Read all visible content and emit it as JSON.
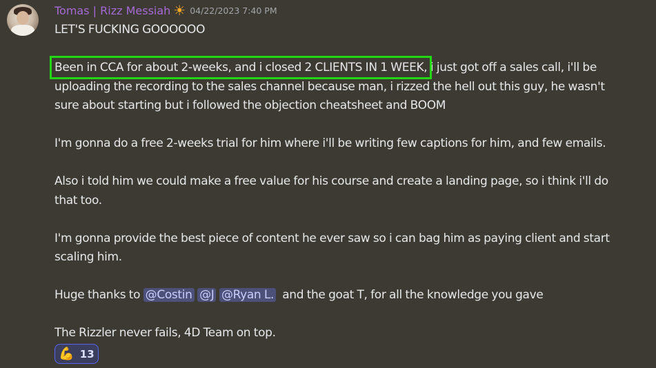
{
  "message": {
    "username": "Tomas | Rizz Messiah",
    "status_emoji": "☀",
    "timestamp": "04/22/2023 7:40 PM",
    "line1": "LET'S FUCKING GOOOOOO",
    "para1_highlight": "Been in CCA for about 2-weeks, and i closed 2 CLIENTS IN 1 WEEK,",
    "para1_rest_a": " i just got off a sales call, i'll be",
    "para1_line2": "uploading the recording to the sales channel because man, i rizzed the hell out this guy, he wasn't",
    "para1_line3": "sure about starting but i followed the objection cheatsheet and BOOM",
    "para2": "I'm gonna do a free 2-weeks trial for him where i'll be writing few captions for him, and few emails.",
    "para3_line1": "Also i told him we could make a free value for his course and create a landing page, so i think i'll do",
    "para3_line2": "that too.",
    "para4_line1": "I'm gonna provide the best piece of content he ever saw so i can bag him as paying client and start",
    "para4_line2": "scaling him.",
    "thanks_prefix": "Huge thanks to ",
    "mentions": [
      "@Costin",
      "@J",
      "@Ryan L."
    ],
    "thanks_suffix": "and the goat T, for all the knowledge you gave",
    "closing": "The Rizzler never fails, 4D Team on top."
  },
  "reaction": {
    "emoji": "💪",
    "count": "13"
  },
  "colors": {
    "background": "#3c3a33",
    "username": "#a66ad7",
    "highlight_box": "#22d814",
    "mention_bg": "#4b5178",
    "reaction_border": "#5865f2"
  }
}
